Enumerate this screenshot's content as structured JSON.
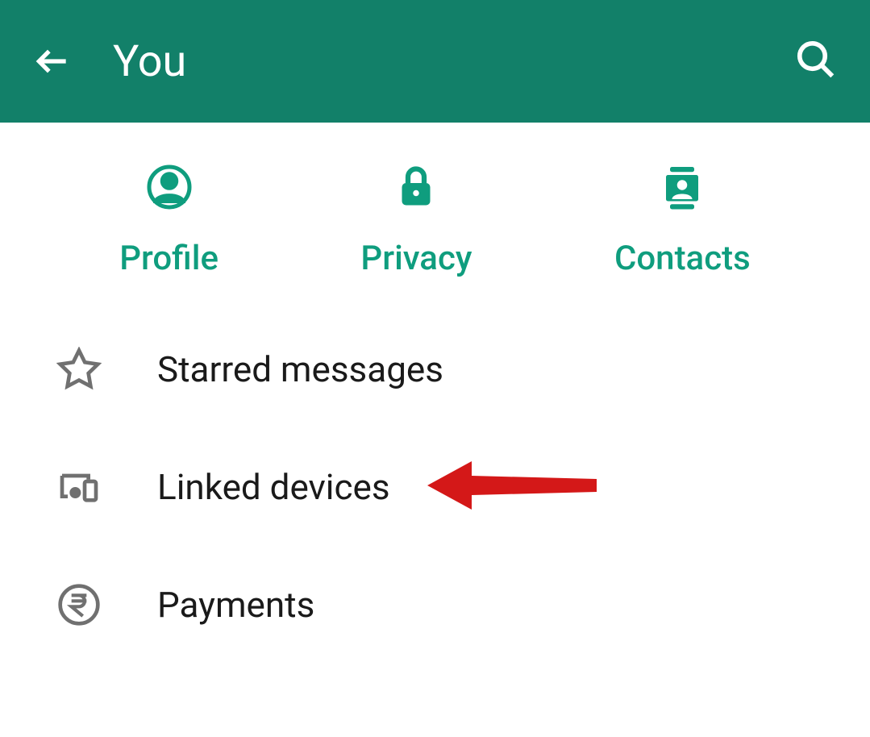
{
  "header": {
    "title": "You"
  },
  "quickActions": [
    {
      "label": "Profile"
    },
    {
      "label": "Privacy"
    },
    {
      "label": "Contacts"
    }
  ],
  "settingsItems": [
    {
      "label": "Starred messages"
    },
    {
      "label": "Linked devices"
    },
    {
      "label": "Payments"
    }
  ]
}
